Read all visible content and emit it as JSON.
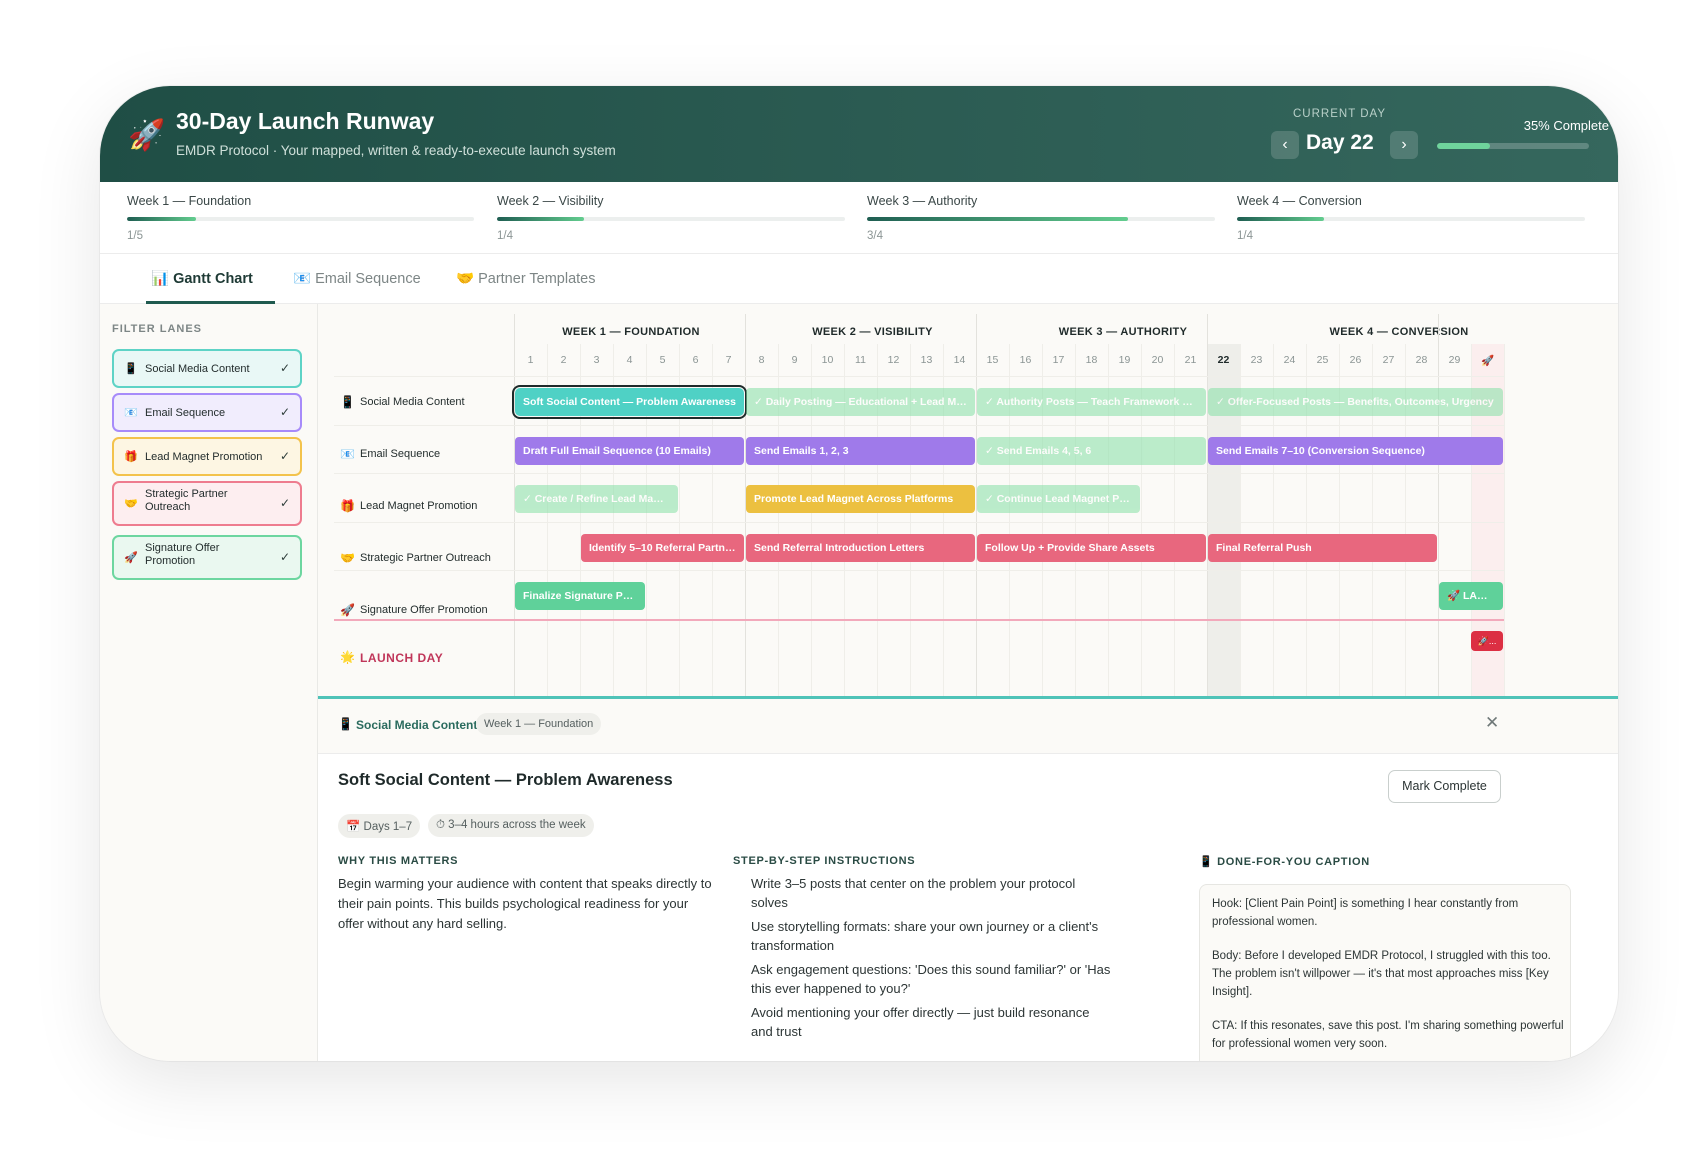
{
  "header": {
    "title": "30-Day Launch Runway",
    "subtitle": "EMDR Protocol · Your mapped, written & ready-to-execute launch system",
    "current_day_label": "CURRENT DAY",
    "current_day": "Day 22",
    "prev_symbol": "‹",
    "next_symbol": "›",
    "progress_label": "35% Complete",
    "progress": 0.35,
    "rocket_icon": "🚀"
  },
  "weeks": [
    {
      "name": "Week 1 — Foundation",
      "count": "1/5",
      "progress": 0.2
    },
    {
      "name": "Week 2 — Visibility",
      "count": "1/4",
      "progress": 0.25
    },
    {
      "name": "Week 3 — Authority",
      "count": "3/4",
      "progress": 0.75
    },
    {
      "name": "Week 4 — Conversion",
      "count": "1/4",
      "progress": 0.25
    }
  ],
  "tabs": [
    {
      "icon": "📊",
      "label": "Gantt Chart"
    },
    {
      "icon": "📧",
      "label": "Email Sequence"
    },
    {
      "icon": "🤝",
      "label": "Partner Templates"
    }
  ],
  "sidebar": {
    "title": "FILTER LANES",
    "check": "✓",
    "lanes": [
      {
        "icon": "📱",
        "label": "Social Media Content",
        "border": "#5ed3c6",
        "bg": "#e9f8f6"
      },
      {
        "icon": "📧",
        "label": "Email Sequence",
        "border": "#a78bfa",
        "bg": "#f1edfd"
      },
      {
        "icon": "🎁",
        "label": "Lead Magnet Promotion",
        "border": "#f3c34c",
        "bg": "#fdf6e3"
      },
      {
        "icon": "🤝",
        "label": "Strategic Partner Outreach",
        "border": "#ee7c8f",
        "bg": "#fdeef0"
      },
      {
        "icon": "🚀",
        "label": "Signature Offer Promotion",
        "border": "#6dd6a0",
        "bg": "#eaf8f0"
      }
    ]
  },
  "gantt": {
    "week_headers": [
      "WEEK 1 — FOUNDATION",
      "WEEK 2 — VISIBILITY",
      "WEEK 3 — AUTHORITY",
      "WEEK 4 — CONVERSION"
    ],
    "days": [
      "1",
      "2",
      "3",
      "4",
      "5",
      "6",
      "7",
      "8",
      "9",
      "10",
      "11",
      "12",
      "13",
      "14",
      "15",
      "16",
      "17",
      "18",
      "19",
      "20",
      "21",
      "22",
      "23",
      "24",
      "25",
      "26",
      "27",
      "28",
      "29"
    ],
    "current_day": 22,
    "final_day_icon": "🚀",
    "lanes": [
      {
        "icon": "📱",
        "label": "Social Media Content"
      },
      {
        "icon": "📧",
        "label": "Email Sequence"
      },
      {
        "icon": "🎁",
        "label": "Lead Magnet Promotion"
      },
      {
        "icon": "🤝",
        "label": "Strategic Partner Outreach"
      },
      {
        "icon": "🚀",
        "label": "Signature Offer Promotion"
      }
    ],
    "launch_row": {
      "icon": "🌟",
      "label": "LAUNCH DAY",
      "marker": "🚀..."
    },
    "bars": [
      {
        "lane": 0,
        "start": 1,
        "end": 7,
        "label": "Soft Social Content — Problem Awareness",
        "color": "#4fd1c5",
        "done": false,
        "selected": true
      },
      {
        "lane": 0,
        "start": 8,
        "end": 14,
        "label": "✓ Daily Posting — Educational + Lead Mag...",
        "color": "#86e0a6",
        "done": true
      },
      {
        "lane": 0,
        "start": 15,
        "end": 21,
        "label": "✓ Authority Posts — Teach Framework Co...",
        "color": "#86e0a6",
        "done": true
      },
      {
        "lane": 0,
        "start": 22,
        "end": 30,
        "label": "✓ Offer-Focused Posts — Benefits, Outcomes, Urgency",
        "color": "#86e0a6",
        "done": true
      },
      {
        "lane": 1,
        "start": 1,
        "end": 7,
        "label": "Draft Full Email Sequence (10 Emails)",
        "color": "#9f7aea",
        "done": false
      },
      {
        "lane": 1,
        "start": 8,
        "end": 14,
        "label": "Send Emails 1, 2, 3",
        "color": "#9f7aea",
        "done": false
      },
      {
        "lane": 1,
        "start": 15,
        "end": 21,
        "label": "✓ Send Emails 4, 5, 6",
        "color": "#86e0a6",
        "done": true
      },
      {
        "lane": 1,
        "start": 22,
        "end": 30,
        "label": "Send Emails 7–10 (Conversion Sequence)",
        "color": "#9f7aea",
        "done": false
      },
      {
        "lane": 2,
        "start": 1,
        "end": 5,
        "label": "✓ Create / Refine Lead Magn...",
        "color": "#86e0a6",
        "done": true
      },
      {
        "lane": 2,
        "start": 8,
        "end": 14,
        "label": "Promote Lead Magnet Across Platforms",
        "color": "#ecc040",
        "done": false
      },
      {
        "lane": 2,
        "start": 15,
        "end": 19,
        "label": "✓ Continue Lead Magnet Pro...",
        "color": "#86e0a6",
        "done": true
      },
      {
        "lane": 3,
        "start": 3,
        "end": 7,
        "label": "Identify 5–10 Referral Partne...",
        "color": "#e8677e",
        "done": false
      },
      {
        "lane": 3,
        "start": 8,
        "end": 14,
        "label": "Send Referral Introduction Letters",
        "color": "#e8677e",
        "done": false
      },
      {
        "lane": 3,
        "start": 15,
        "end": 21,
        "label": "Follow Up + Provide Share Assets",
        "color": "#e8677e",
        "done": false
      },
      {
        "lane": 3,
        "start": 22,
        "end": 28,
        "label": "Final Referral Push",
        "color": "#e8677e",
        "done": false
      },
      {
        "lane": 4,
        "start": 1,
        "end": 4,
        "label": "Finalize Signature Pro...",
        "color": "#5fd19a",
        "done": false
      },
      {
        "lane": 4,
        "start": 29,
        "end": 30,
        "label": "🚀 LAUN...",
        "color": "#5fd19a",
        "done": false
      }
    ]
  },
  "detail": {
    "lane_icon": "📱",
    "lane": "Social Media Content",
    "week": "Week 1 — Foundation",
    "close": "✕",
    "title": "Soft Social Content — Problem Awareness",
    "mark_complete": "Mark Complete",
    "days_chip": "📅 Days 1–7",
    "hours_chip": "⏱ 3–4 hours across the week",
    "why_title": "WHY THIS MATTERS",
    "why_text": "Begin warming your audience with content that speaks directly to their pain points. This builds psychological readiness for your offer without any hard selling.",
    "steps_title": "STEP-BY-STEP INSTRUCTIONS",
    "steps": [
      "Write 3–5 posts that center on the problem your protocol solves",
      "Use storytelling formats: share your own journey or a client's transformation",
      "Ask engagement questions: 'Does this sound familiar?' or 'Has this ever happened to you?'",
      "Avoid mentioning your offer directly — just build resonance and trust"
    ],
    "caption_title": "📱 DONE-FOR-YOU CAPTION",
    "caption_hook": "Hook: [Client Pain Point] is something I hear constantly from professional women.",
    "caption_body": "Body: Before I developed EMDR Protocol, I struggled with this too. The problem isn't willpower — it's that most approaches miss [Key Insight].",
    "caption_cta": "CTA: If this resonates, save this post. I'm sharing something powerful for professional women very soon."
  }
}
